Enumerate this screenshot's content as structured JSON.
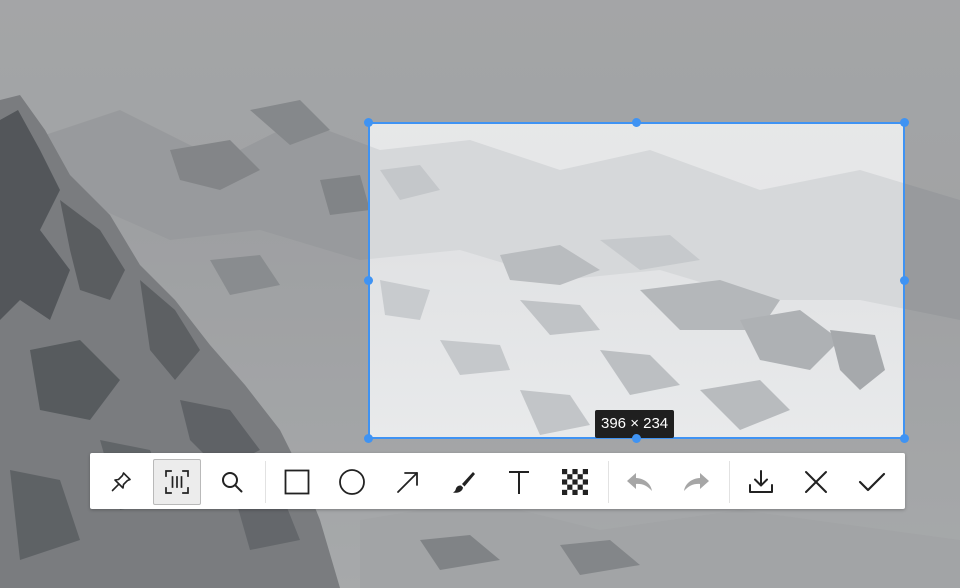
{
  "selection": {
    "size_label": "396 × 234",
    "accent_color": "#3f93f3"
  },
  "toolbar": {
    "tools": [
      {
        "name": "pin",
        "icon": "pin-icon",
        "active": false
      },
      {
        "name": "ocr",
        "icon": "text-recognition-icon",
        "active": true
      },
      {
        "name": "search",
        "icon": "search-icon",
        "active": false
      },
      {
        "name": "rectangle",
        "icon": "rectangle-icon",
        "active": false
      },
      {
        "name": "ellipse",
        "icon": "ellipse-icon",
        "active": false
      },
      {
        "name": "arrow",
        "icon": "arrow-icon",
        "active": false
      },
      {
        "name": "brush",
        "icon": "brush-icon",
        "active": false
      },
      {
        "name": "text",
        "icon": "text-icon",
        "active": false
      },
      {
        "name": "mosaic",
        "icon": "mosaic-icon",
        "active": false
      },
      {
        "name": "undo",
        "icon": "undo-icon",
        "active": false,
        "disabled": true
      },
      {
        "name": "redo",
        "icon": "redo-icon",
        "active": false,
        "disabled": true
      },
      {
        "name": "save",
        "icon": "download-icon",
        "active": false
      },
      {
        "name": "cancel",
        "icon": "close-icon",
        "active": false
      },
      {
        "name": "confirm",
        "icon": "check-icon",
        "active": false
      }
    ]
  }
}
